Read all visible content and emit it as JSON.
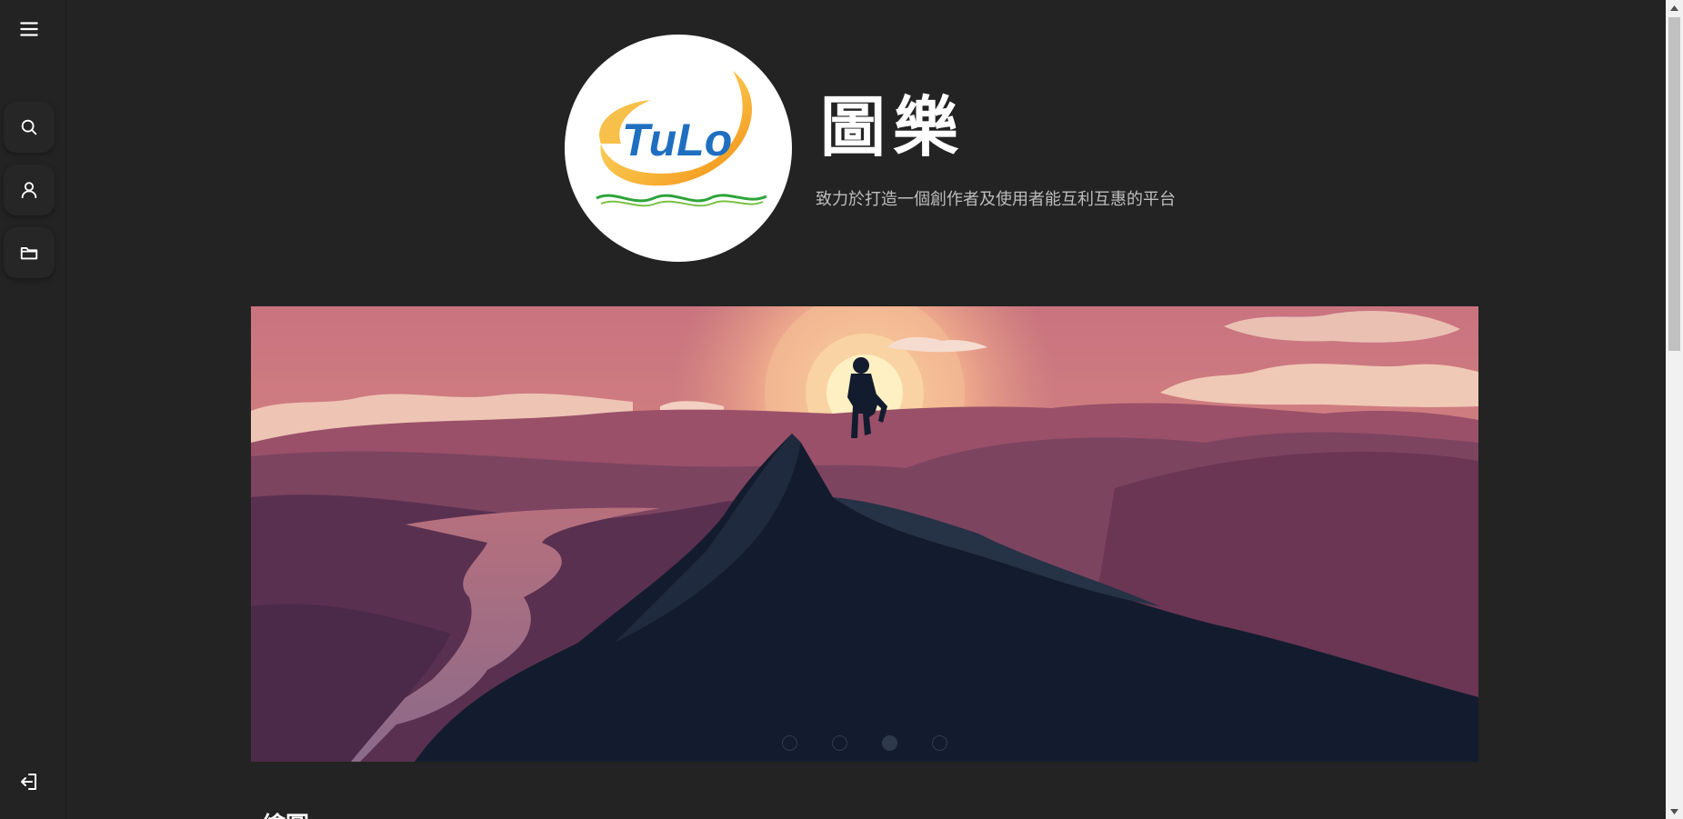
{
  "app": {
    "title": "圖樂",
    "subtitle": "致力於打造一個創作者及使用者能互利互惠的平台",
    "logo_text": "TuLo"
  },
  "sidebar": {
    "items": [
      {
        "icon": "menu-icon"
      },
      {
        "icon": "search-icon"
      },
      {
        "icon": "user-icon"
      },
      {
        "icon": "folder-icon"
      },
      {
        "icon": "logout-icon"
      }
    ]
  },
  "carousel": {
    "slide_count": 4,
    "active_index": 2
  },
  "section": {
    "heading": "繪圖"
  },
  "colors": {
    "background": "#232323",
    "accent_blue": "#1f6fc0",
    "accent_orange": "#f5a623"
  }
}
